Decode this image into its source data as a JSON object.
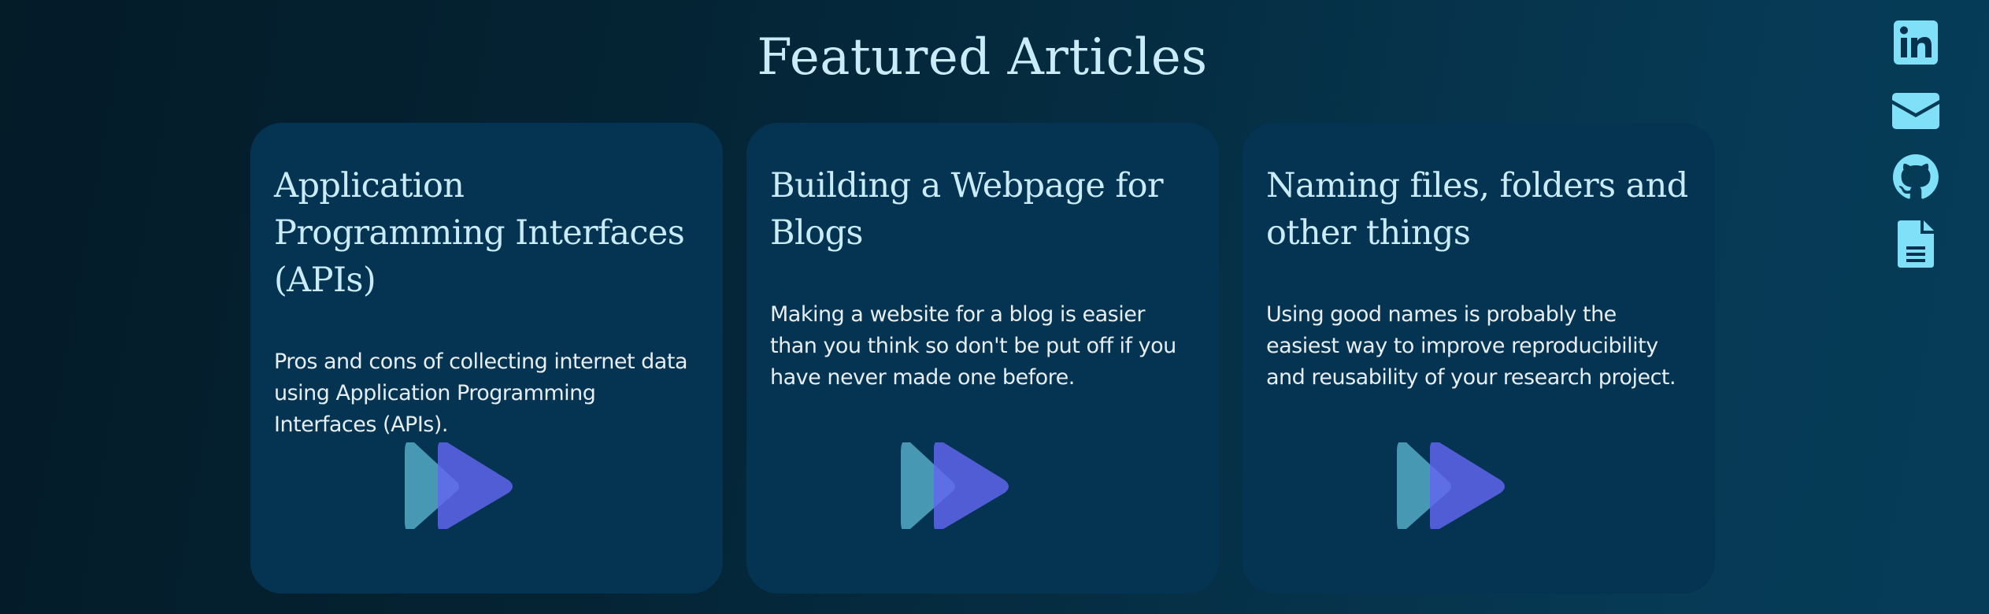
{
  "page": {
    "title": "Featured Articles"
  },
  "articles": [
    {
      "title": "Application Programming Interfaces (APIs)",
      "description": "Pros and cons of collecting internet data using Application Programming Interfaces (APIs).",
      "image_icon": "play-forward-icon"
    },
    {
      "title": "Building a Webpage for Blogs",
      "description": "Making a website for a blog is easier than you think so don't be put off if you have never made one before.",
      "image_icon": "play-forward-icon"
    },
    {
      "title": "Naming files, folders and other things",
      "description": "Using good names is probably the easiest way to improve reproducibility and reusability of your research project.",
      "image_icon": "play-forward-icon"
    }
  ],
  "social_links": [
    {
      "name": "linkedin",
      "icon": "linkedin-icon"
    },
    {
      "name": "email",
      "icon": "envelope-icon"
    },
    {
      "name": "github",
      "icon": "github-icon"
    },
    {
      "name": "cv",
      "icon": "document-icon"
    }
  ],
  "colors": {
    "title_text": "#c9ecf8",
    "card_background": "#053452",
    "body_text": "#e6eef2",
    "social_icon": "#7fe0f8",
    "art_teal": "#4fa3bd",
    "art_indigo": "#6366f1"
  }
}
